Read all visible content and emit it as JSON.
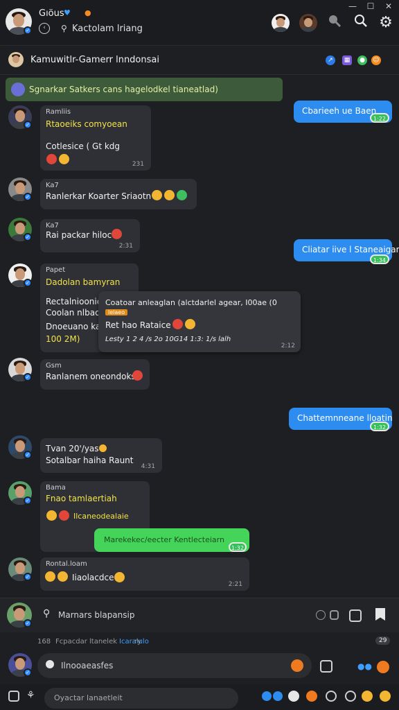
{
  "window": {
    "minimize": "—",
    "maximize": "☐",
    "close": "✕"
  },
  "header": {
    "title": "Gıöus",
    "subtitle": "Kactolam lriang",
    "icons": [
      "user-avatar-1",
      "user-avatar-2",
      "zoom-icon",
      "search-icon",
      "gear-icon"
    ]
  },
  "channel": {
    "title": "Kamuwitlr-Gamerr lnndonsai"
  },
  "pinned": {
    "text": "Sgnarkar Satkers cans hagelodkel tianeatlad)"
  },
  "messages": [
    {
      "name": "Ramliis",
      "lines": [
        "Rtaoeiks comyoean",
        "Cotlesice ( Gt kdg"
      ],
      "time": "231"
    },
    {
      "name": "Ka7",
      "lines": [
        "Ranlerkar Koarter Sriaotn"
      ],
      "time": ""
    },
    {
      "name": "Ka7",
      "lines": [
        "Rai packar hiloce"
      ],
      "time": "2:31"
    },
    {
      "name": "Papet",
      "lines": [
        "Dadolan bamyran",
        "Rectalnioonic",
        "Coolan nlbao",
        "Dnoeuano kaio",
        "100 2M)"
      ],
      "time": ""
    },
    {
      "name": "Gsm",
      "lines": [
        "Ranlanem oneondoks"
      ],
      "time": ""
    },
    {
      "name": "",
      "lines": [
        "Tvan 20'/yas",
        "Sotalbar haiha Raunt"
      ],
      "time": "4:31"
    },
    {
      "name": "Bama",
      "lines": [
        "Fnao tamlaertiah",
        "Ilcaneodealaie"
      ],
      "time": ""
    },
    {
      "name": "Rontal.loam",
      "lines": [
        "Iiaolacdce"
      ],
      "time": "2:21"
    }
  ],
  "popup": {
    "line1": "Coatoar anleaglan (alctdarlel agear, I00ae (0",
    "tag": "lelaeo",
    "line2": "Ret hao Rataice",
    "stats": "Lesty 1  2  4  /s  2o  10G14  1:3: 1/s  lalh",
    "time": "2:12"
  },
  "outgoing": [
    {
      "text": "Cbarieeh ue Baen",
      "read": "1:22"
    },
    {
      "text": "Cliatar iive l Staneaigan",
      "read": "1:34"
    },
    {
      "text": "Chattemnneane lloatin",
      "read": "1:32"
    }
  ],
  "green_message": {
    "text": "Marekekec/eecter Kentlecteiarn",
    "read": "1:32"
  },
  "composer": {
    "placeholder": "Marnars blapansip"
  },
  "typing": {
    "count": "168",
    "text": "Fcpacdar ltanelek",
    "link": "Icaralulo",
    "suffix": "ry",
    "badge": "29"
  },
  "input": {
    "placeholder": "Ilnooaeasfes"
  },
  "bottom": {
    "placeholder": "Oyactar lanaetleit"
  }
}
